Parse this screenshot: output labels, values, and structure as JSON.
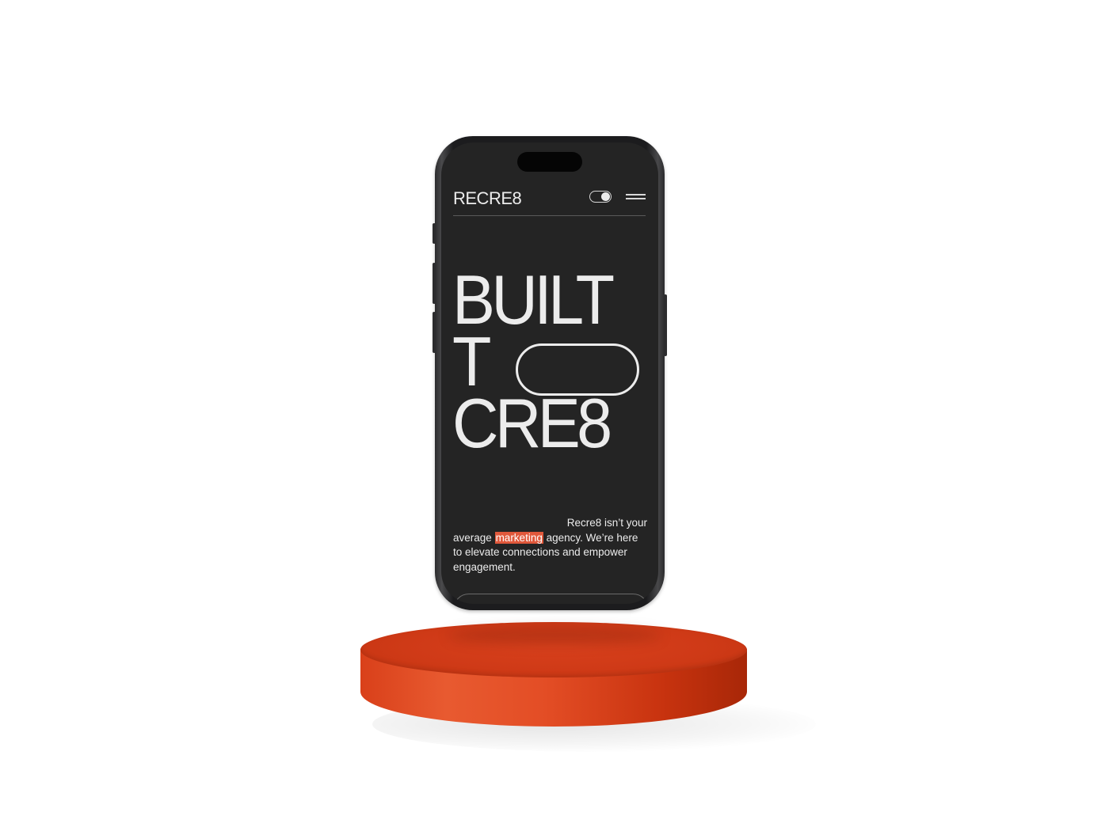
{
  "header": {
    "logo": "RECRE8",
    "toggle_state": "on"
  },
  "hero": {
    "line1": "BUILT",
    "line2": "T",
    "line3": "CRE8"
  },
  "intro": {
    "part1": "Recre8 isn’t your",
    "part2": "average",
    "highlight": "marketing",
    "part3": "agency. We’re here to elevate connections and empower engagement."
  },
  "colors": {
    "screen_bg": "#242424",
    "text": "#ececec",
    "accent": "#e0583b",
    "pedestal": "#d8401c"
  },
  "icons": {
    "toggle": "toggle-switch-icon",
    "menu": "hamburger-menu-icon"
  }
}
